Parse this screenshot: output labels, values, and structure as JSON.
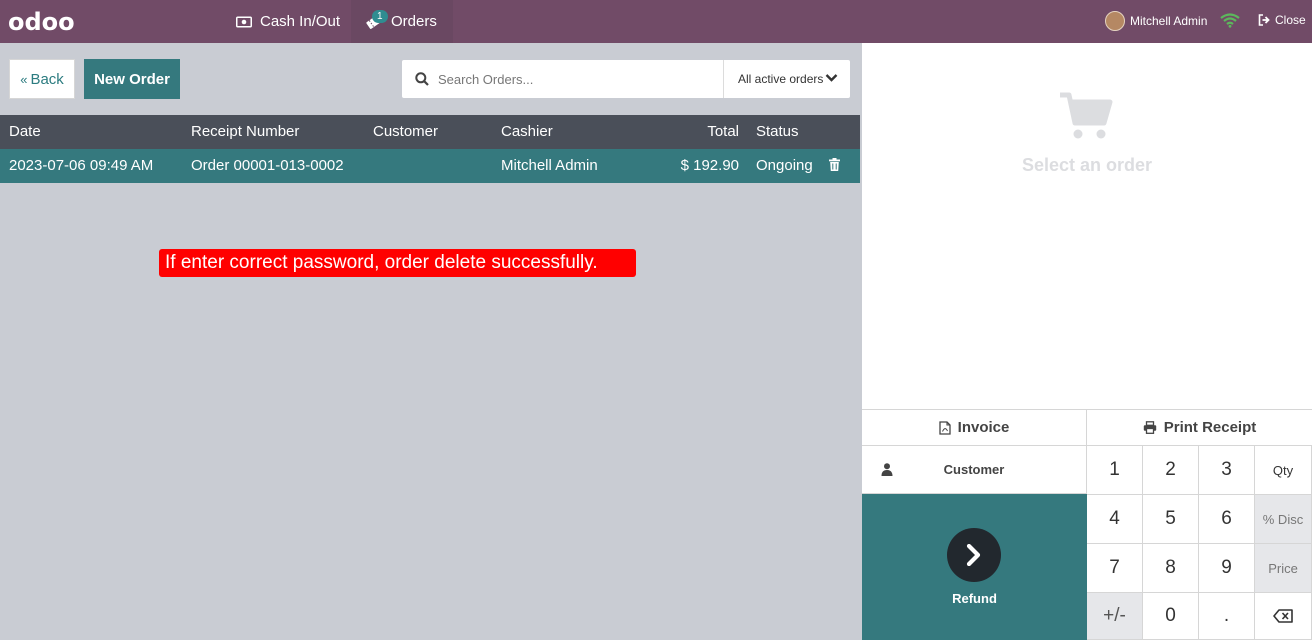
{
  "topbar": {
    "logo": "odoo",
    "cash_label": "Cash In/Out",
    "orders_label": "Orders",
    "orders_badge": "1",
    "user_name": "Mitchell Admin",
    "close_label": "Close"
  },
  "controls": {
    "back_label": "Back",
    "new_order_label": "New Order",
    "search_placeholder": "Search Orders...",
    "filter_value": "All active orders"
  },
  "table": {
    "headers": {
      "date": "Date",
      "receipt": "Receipt Number",
      "customer": "Customer",
      "cashier": "Cashier",
      "total": "Total",
      "status": "Status"
    },
    "rows": [
      {
        "date": "2023-07-06 09:49 AM",
        "receipt": "Order 00001-013-0002",
        "customer": "",
        "cashier": "Mitchell Admin",
        "total": "$ 192.90",
        "status": "Ongoing"
      }
    ]
  },
  "annotation": "If enter correct password, order delete successfully.",
  "right_pane": {
    "empty_text": "Select an order",
    "invoice_label": "Invoice",
    "print_label": "Print Receipt",
    "customer_label": "Customer",
    "refund_label": "Refund",
    "keys": {
      "k1": "1",
      "k2": "2",
      "k3": "3",
      "qty": "Qty",
      "k4": "4",
      "k5": "5",
      "k6": "6",
      "disc": "% Disc",
      "k7": "7",
      "k8": "8",
      "k9": "9",
      "price": "Price",
      "sign": "+/-",
      "k0": "0",
      "dot": "."
    }
  },
  "colors": {
    "topbar": "#714b67",
    "accent": "#35797e",
    "table_header": "#4a4f59",
    "annotation": "#ff0000"
  }
}
